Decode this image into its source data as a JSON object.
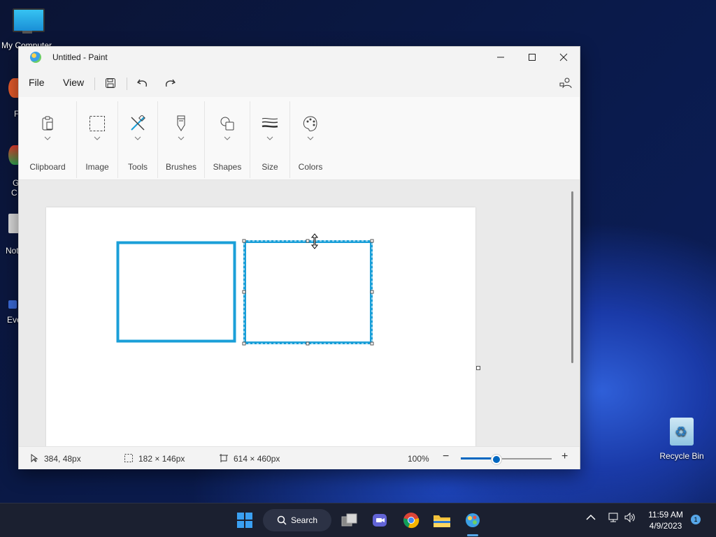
{
  "desktop": {
    "icons": [
      {
        "label": "My Computer"
      },
      {
        "label": "F"
      },
      {
        "label": "G"
      },
      {
        "label": "C"
      },
      {
        "label": "Not"
      },
      {
        "label": "Eve"
      }
    ],
    "recycle_bin": {
      "label": "Recycle Bin"
    }
  },
  "window": {
    "title": "Untitled - Paint",
    "menu": {
      "file": "File",
      "view": "View"
    },
    "ribbon": {
      "groups": [
        {
          "label": "Clipboard",
          "icon": "clipboard-icon"
        },
        {
          "label": "Image",
          "icon": "selection-icon"
        },
        {
          "label": "Tools",
          "icon": "tools-icon"
        },
        {
          "label": "Brushes",
          "icon": "brush-icon"
        },
        {
          "label": "Shapes",
          "icon": "shapes-icon"
        },
        {
          "label": "Size",
          "icon": "size-icon"
        },
        {
          "label": "Colors",
          "icon": "palette-icon"
        }
      ]
    },
    "status": {
      "cursor_pos": "384, 48px",
      "selection_size": "182 × 146px",
      "canvas_size": "614 × 460px",
      "zoom": "100%",
      "zoom_level": 0.38
    },
    "accent": "#1a9fd8"
  },
  "taskbar": {
    "search_label": "Search",
    "time": "11:59 AM",
    "date": "4/9/2023",
    "notifications": "1"
  }
}
